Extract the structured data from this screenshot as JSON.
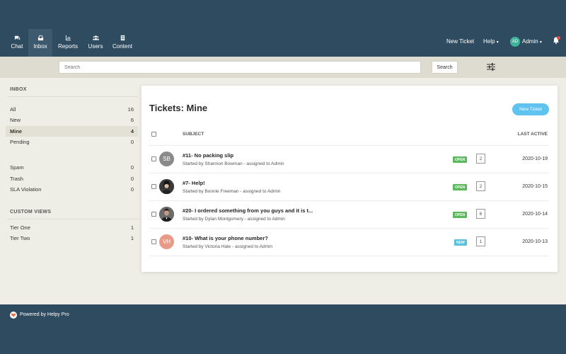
{
  "nav": {
    "items": [
      {
        "label": "Chat",
        "icon": "chat-icon"
      },
      {
        "label": "Inbox",
        "icon": "inbox-icon"
      },
      {
        "label": "Reports",
        "icon": "reports-icon"
      },
      {
        "label": "Users",
        "icon": "users-icon"
      },
      {
        "label": "Content",
        "icon": "content-icon"
      }
    ],
    "new_ticket": "New Ticket",
    "help": "Help",
    "user_initials": "AD",
    "user_name": "Admin"
  },
  "search": {
    "placeholder": "Search",
    "button": "Search"
  },
  "sidebar": {
    "inbox_heading": "INBOX",
    "inbox_items": [
      {
        "label": "All",
        "count": "16"
      },
      {
        "label": "New",
        "count": "6"
      },
      {
        "label": "Mine",
        "count": "4"
      },
      {
        "label": "Pending",
        "count": "0"
      },
      {
        "label": "Spam",
        "count": "0"
      },
      {
        "label": "Trash",
        "count": "0"
      },
      {
        "label": "SLA Violation",
        "count": "0"
      }
    ],
    "custom_heading": "CUSTOM VIEWS",
    "custom_items": [
      {
        "label": "Tier One",
        "count": "1"
      },
      {
        "label": "Tier Two",
        "count": "1"
      }
    ]
  },
  "tickets": {
    "title": "Tickets: Mine",
    "new_button": "New Ticket",
    "col_subject": "SUBJECT",
    "col_last_active": "LAST ACTIVE",
    "rows": [
      {
        "initials": "SB",
        "subject": "#11- No packing slip",
        "meta": "Started by Shannon Bowman - assigned to Admin",
        "status": "OPEN",
        "count": "2",
        "date": "2020-10-19"
      },
      {
        "initials": "",
        "subject": "#7- Help!",
        "meta": "Started by Bonnie Freeman - assigned to Admin",
        "status": "OPEN",
        "count": "2",
        "date": "2020-10-15"
      },
      {
        "initials": "",
        "subject": "#20- I ordered something from you guys and it is t...",
        "meta": "Started by Dylan Montgomery - assigned to Admin",
        "status": "OPEN",
        "count": "6",
        "date": "2020-10-14"
      },
      {
        "initials": "VH",
        "subject": "#10- What is your phone number?",
        "meta": "Started by Victoria Hale - assigned to Admin",
        "status": "NEW",
        "count": "1",
        "date": "2020-10-13"
      }
    ]
  },
  "colors": {
    "nav_bg": "#2f4b5f",
    "open": "#5cb85c",
    "new": "#5bc0de",
    "accent": "#60c2ee"
  },
  "footer": {
    "text": "Powered by Helpy Pro"
  }
}
